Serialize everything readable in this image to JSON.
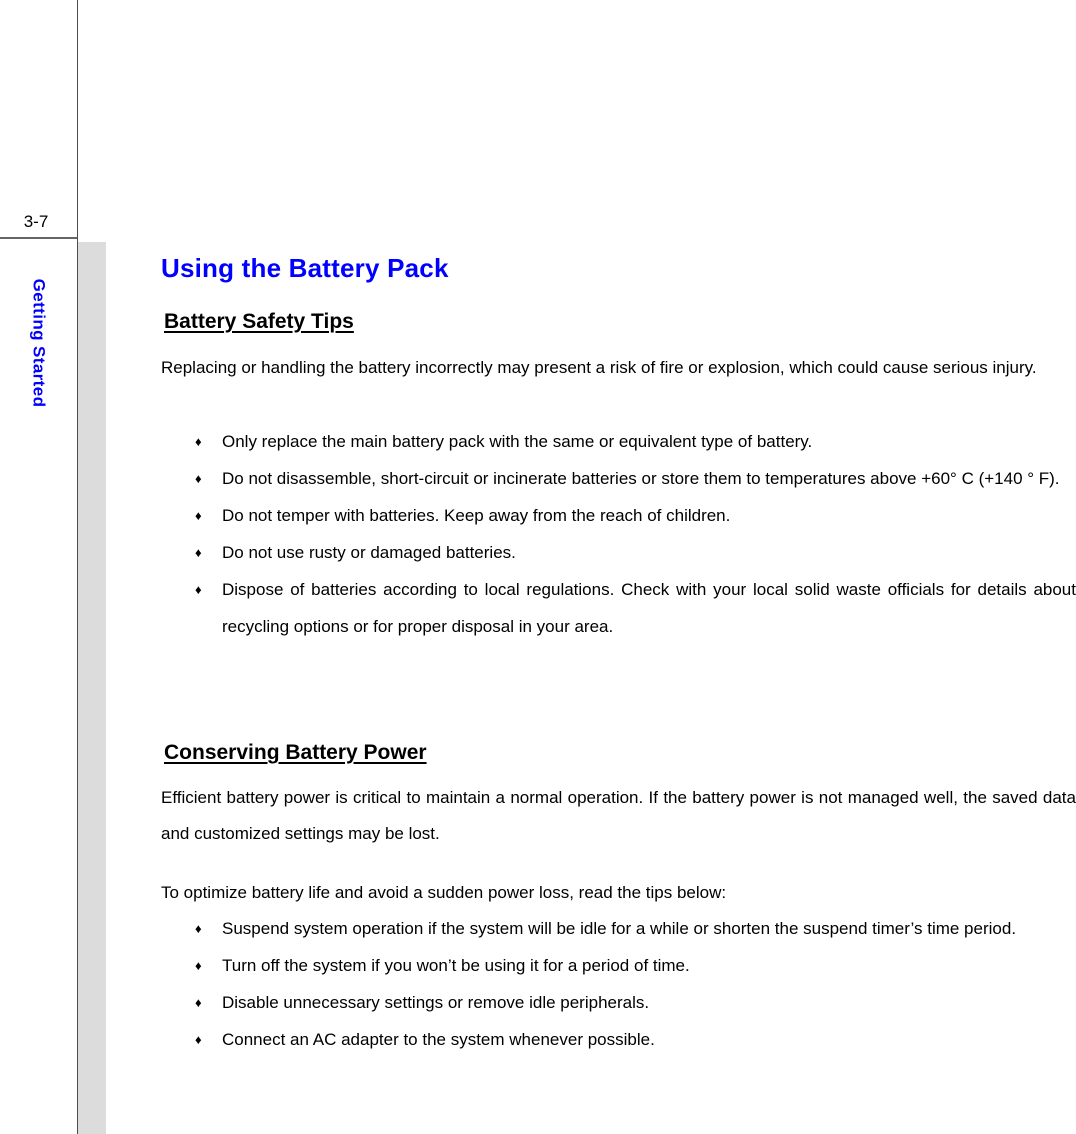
{
  "page": {
    "folio": "3-7",
    "chapter_tab": "Getting Started",
    "accent_color": "#0000ff",
    "band_color": "#dcdcdc",
    "rule_color": "#4d4d4d"
  },
  "title": "Using the Battery Pack",
  "sections": [
    {
      "heading": "Battery Safety Tips",
      "intro": "Replacing or handling the battery incorrectly may present a risk of fire or explosion, which could cause serious injury.",
      "bullet_glyph": "♦",
      "bullets": [
        "Only replace the main battery pack with the same or equivalent type of battery.",
        "Do not disassemble, short-circuit or incinerate batteries or store them to temperatures above +60° C (+140 ° F).",
        "Do not temper with batteries.   Keep away from the reach of children.",
        "Do not use rusty or damaged batteries.",
        "Dispose of batteries according to local regulations.   Check with your local solid waste officials for details about recycling options or for proper disposal in your area."
      ]
    },
    {
      "heading": "Conserving Battery Power",
      "intro": "Efficient battery power is critical to maintain a normal operation.   If the battery power is not managed well, the saved data and customized settings may be lost.",
      "lead": "To optimize battery life and avoid a sudden power loss, read the tips below:",
      "bullet_glyph": "♦",
      "bullets": [
        "Suspend system operation if the system will be idle for a while or shorten the suspend timer’s time period.",
        "Turn off the system if you won’t be using it for a period of time.",
        "Disable unnecessary settings or remove idle peripherals.",
        "Connect an AC adapter to the system whenever possible."
      ]
    }
  ]
}
